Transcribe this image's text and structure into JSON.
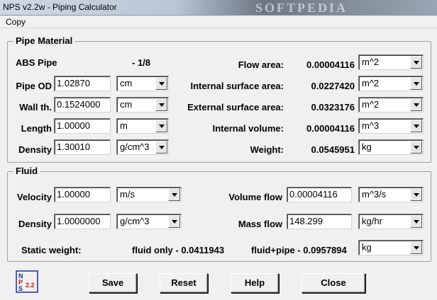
{
  "window": {
    "title": "NPS v2.2w - Piping Calculator",
    "watermark": "SOFTPEDIA"
  },
  "menu": {
    "copy": "Copy"
  },
  "pipe_material": {
    "group_title": "Pipe Material",
    "pipe_name": "ABS Pipe",
    "pipe_size": "- 1/8",
    "pipe_od": {
      "label": "Pipe OD",
      "value": "1.02870",
      "unit": "cm"
    },
    "wall_thickness": {
      "label": "Wall th.",
      "value": "0.1524000",
      "unit": "cm"
    },
    "length": {
      "label": "Length",
      "value": "1.00000",
      "unit": "m"
    },
    "density": {
      "label": "Density",
      "value": "1.30010",
      "unit": "g/cm^3"
    },
    "flow_area": {
      "label": "Flow area:",
      "value": "0.00004116",
      "unit": "m^2"
    },
    "internal_surface_area": {
      "label": "Internal surface area:",
      "value": "0.0227420",
      "unit": "m^2"
    },
    "external_surface_area": {
      "label": "External surface area:",
      "value": "0.0323176",
      "unit": "m^2"
    },
    "internal_volume": {
      "label": "Internal volume:",
      "value": "0.00004116",
      "unit": "m^3"
    },
    "weight": {
      "label": "Weight:",
      "value": "0.0545951",
      "unit": "kg"
    }
  },
  "fluid": {
    "group_title": "Fluid",
    "velocity": {
      "label": "Velocity",
      "value": "1.00000",
      "unit": "m/s"
    },
    "density": {
      "label": "Density",
      "value": "1.0000000",
      "unit": "g/cm^3"
    },
    "volume_flow": {
      "label": "Volume flow",
      "value": "0.00004116",
      "unit": "m^3/s"
    },
    "mass_flow": {
      "label": "Mass flow",
      "value": "148.299",
      "unit": "kg/hr"
    },
    "static_weight": {
      "label": "Static weight:",
      "fluid_only": "fluid only -  0.0411943",
      "fluid_pipe": "fluid+pipe -  0.0957894",
      "unit": "kg"
    }
  },
  "buttons": {
    "save": "Save",
    "reset": "Reset",
    "help": "Help",
    "close": "Close"
  },
  "logo": {
    "letters": "NPS",
    "version": "2.2"
  }
}
